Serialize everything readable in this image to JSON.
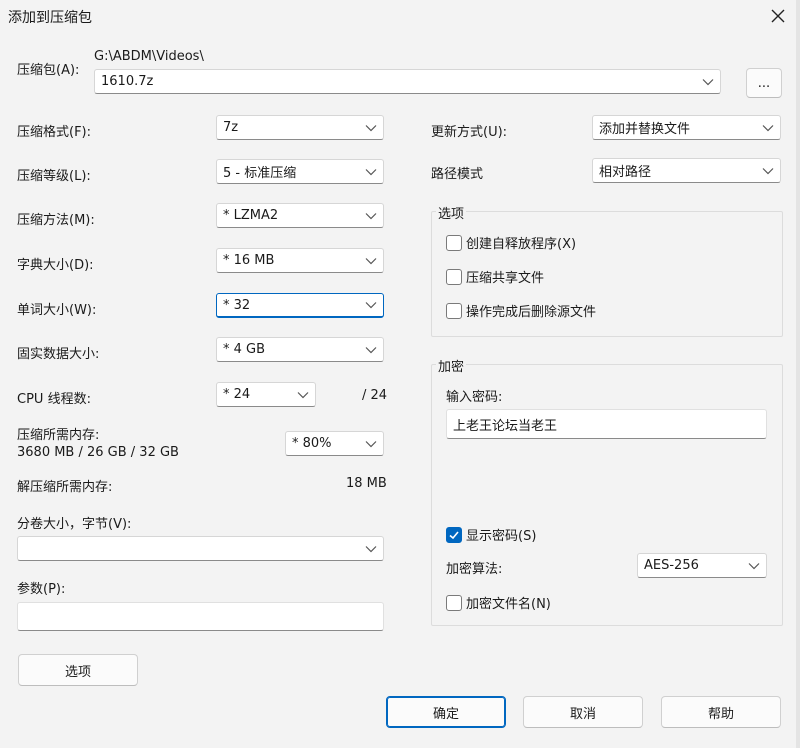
{
  "window": {
    "title": "添加到压缩包"
  },
  "archive": {
    "label": "压缩包(A):",
    "path": "G:\\ABDM\\Videos\\",
    "value": "1610.7z",
    "browse_label": "..."
  },
  "left": {
    "format": {
      "label": "压缩格式(F):",
      "value": "7z"
    },
    "level": {
      "label": "压缩等级(L):",
      "value": "5 - 标准压缩"
    },
    "method": {
      "label": "压缩方法(M):",
      "value": "*  LZMA2"
    },
    "dict": {
      "label": "字典大小(D):",
      "value": "*  16 MB"
    },
    "word": {
      "label": "单词大小(W):",
      "value": "*  32"
    },
    "solid": {
      "label": "固实数据大小:",
      "value": "*  4 GB"
    },
    "threads": {
      "label": "CPU 线程数:",
      "value": "*  24",
      "max": "/ 24"
    },
    "mem_compress": {
      "label": "压缩所需内存:",
      "detail": "3680 MB / 26 GB / 32 GB",
      "value": "*  80%"
    },
    "mem_decompress": {
      "label": "解压缩所需内存:",
      "value": "18 MB"
    },
    "volume": {
      "label": "分卷大小，字节(V):",
      "value": ""
    },
    "params": {
      "label": "参数(P):",
      "value": ""
    },
    "options_button": "选项"
  },
  "right": {
    "update": {
      "label": "更新方式(U):",
      "value": "添加并替换文件"
    },
    "pathmode": {
      "label": "路径模式",
      "value": "相对路径"
    },
    "options_group": {
      "title": "选项",
      "sfx": "创建自释放程序(X)",
      "shared": "压缩共享文件",
      "delete": "操作完成后删除源文件"
    },
    "encrypt_group": {
      "title": "加密",
      "password_label": "输入密码:",
      "password_value": "上老王论坛当老王",
      "show_password": "显示密码(S)",
      "method_label": "加密算法:",
      "method_value": "AES-256",
      "encrypt_names": "加密文件名(N)"
    }
  },
  "buttons": {
    "ok": "确定",
    "cancel": "取消",
    "help": "帮助"
  },
  "colors": {
    "accent": "#0067c0",
    "background": "#f3f3f3"
  }
}
